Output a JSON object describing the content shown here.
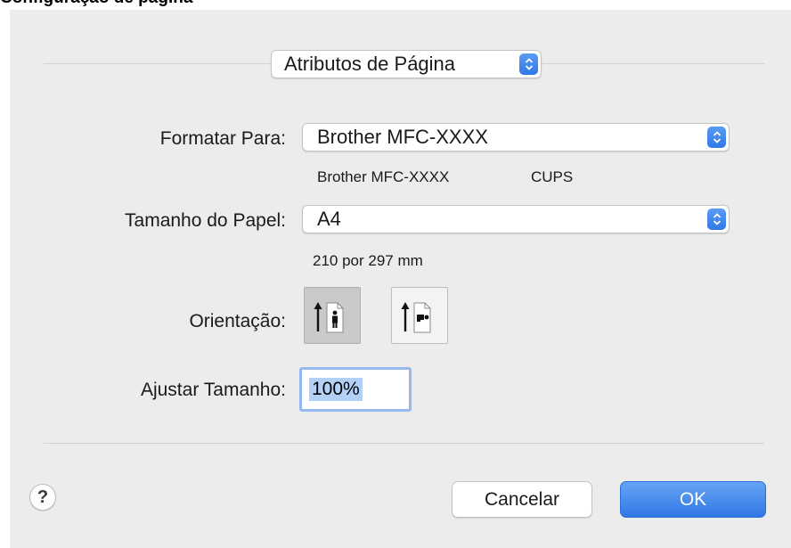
{
  "page_heading": "Configuração de página",
  "dialog": {
    "settings_popup": {
      "value": "Atributos de Página"
    },
    "format_for": {
      "label": "Formatar Para:",
      "value": "Brother MFC-XXXX",
      "printer_name": "Brother MFC-XXXX",
      "printer_type": "CUPS"
    },
    "paper_size": {
      "label": "Tamanho do Papel:",
      "value": "A4",
      "dimensions": "210 por 297 mm"
    },
    "orientation": {
      "label": "Orientação:",
      "options": [
        {
          "icon": "portrait-orientation-icon",
          "selected": true
        },
        {
          "icon": "landscape-orientation-icon",
          "selected": false
        }
      ]
    },
    "scale": {
      "label": "Ajustar Tamanho:",
      "value": "100%"
    },
    "buttons": {
      "help": "?",
      "cancel": "Cancelar",
      "ok": "OK"
    }
  },
  "colors": {
    "dialog_bg": "#ececec",
    "accent": "#2f78e6",
    "focus_ring": "#95b8ee",
    "selection": "#b3d1f7"
  }
}
